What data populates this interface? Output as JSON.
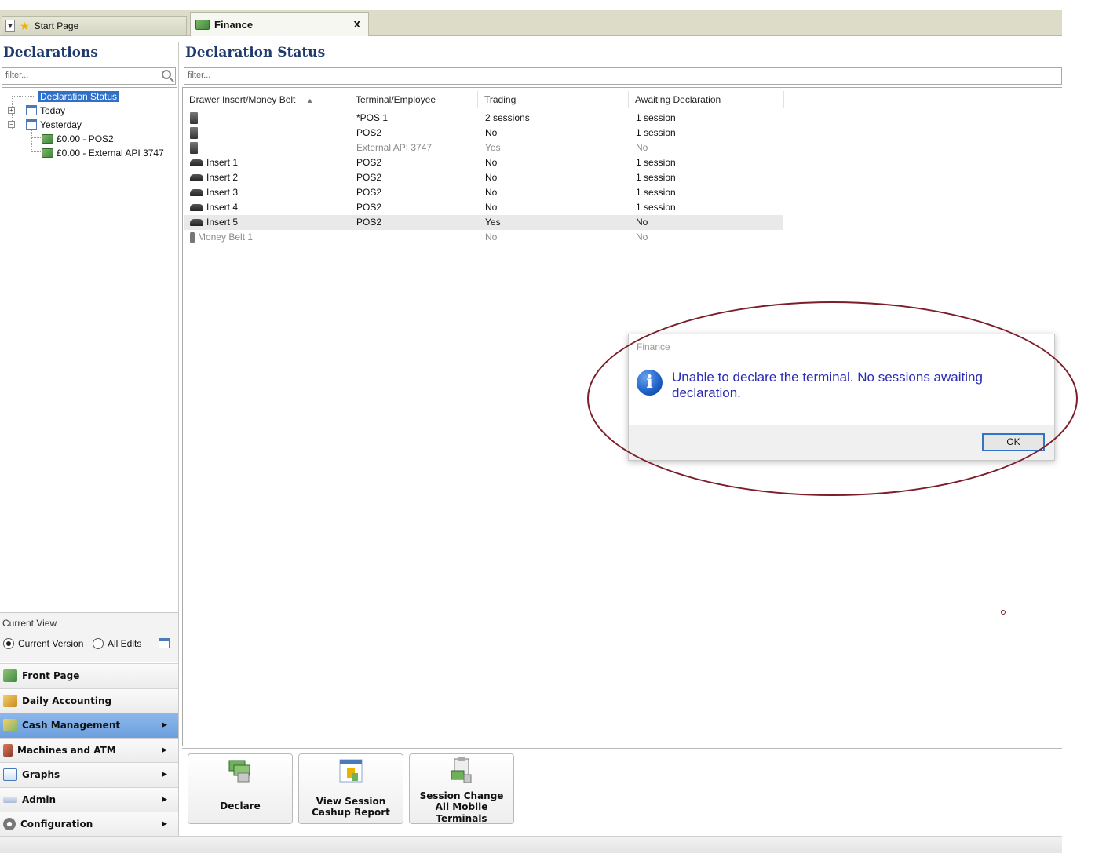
{
  "tabs": {
    "start_page": "Start Page",
    "finance": "Finance",
    "close_glyph": "x"
  },
  "left_panel": {
    "title": "Declarations",
    "filter_placeholder": "filter...",
    "tree": {
      "root": "Declaration Status",
      "today": "Today",
      "yesterday": "Yesterday",
      "child1": "£0.00 - POS2",
      "child2": "£0.00 - External API 3747"
    },
    "current_view": {
      "label": "Current View",
      "option1": "Current Version",
      "option2": "All Edits",
      "selected": "Current Version"
    },
    "nav": [
      {
        "label": "Front Page",
        "icon": "finance-icon"
      },
      {
        "label": "Daily Accounting",
        "icon": "accounting-icon"
      },
      {
        "label": "Cash Management",
        "icon": "cash-icon",
        "active": true
      },
      {
        "label": "Machines and ATM",
        "icon": "machine-icon"
      },
      {
        "label": "Graphs",
        "icon": "graph-icon"
      },
      {
        "label": "Admin",
        "icon": "admin-icon"
      },
      {
        "label": "Configuration",
        "icon": "gear-icon"
      }
    ]
  },
  "main_panel": {
    "title": "Declaration Status",
    "filter_placeholder": "filter...",
    "columns": [
      "Drawer Insert/Money Belt",
      "Terminal/Employee",
      "Trading",
      "Awaiting Declaration"
    ],
    "rows": [
      {
        "icon": "terminal-icon",
        "drawer": "",
        "terminal": "*POS 1",
        "trading": "2 sessions",
        "awaiting": "1 session"
      },
      {
        "icon": "terminal-icon",
        "drawer": "",
        "terminal": "POS2",
        "trading": "No",
        "awaiting": "1 session"
      },
      {
        "icon": "terminal-icon",
        "drawer": "",
        "terminal": "External API 3747",
        "trading": "Yes",
        "awaiting": "No",
        "dim": true
      },
      {
        "icon": "insert-icon",
        "drawer": "Insert 1",
        "terminal": "POS2",
        "trading": "No",
        "awaiting": "1 session"
      },
      {
        "icon": "insert-icon",
        "drawer": "Insert 2",
        "terminal": "POS2",
        "trading": "No",
        "awaiting": "1 session"
      },
      {
        "icon": "insert-icon",
        "drawer": "Insert 3",
        "terminal": "POS2",
        "trading": "No",
        "awaiting": "1 session"
      },
      {
        "icon": "insert-icon",
        "drawer": "Insert 4",
        "terminal": "POS2",
        "trading": "No",
        "awaiting": "1 session"
      },
      {
        "icon": "insert-icon",
        "drawer": "Insert 5",
        "terminal": "POS2",
        "trading": "Yes",
        "awaiting": "No",
        "highlight": true
      },
      {
        "icon": "person-icon",
        "drawer": "Money Belt 1",
        "terminal": "",
        "trading": "No",
        "awaiting": "No",
        "dim": true
      }
    ]
  },
  "actions": {
    "declare": "Declare",
    "view_session_line1": "View Session",
    "view_session_line2": "Cashup Report",
    "session_change_line1": "Session Change",
    "session_change_line2": "All Mobile",
    "session_change_line3": "Terminals"
  },
  "dialog": {
    "title": "Finance",
    "message": "Unable to declare the terminal. No sessions awaiting declaration.",
    "ok": "OK"
  },
  "colors": {
    "title_blue": "#1f3b6e",
    "selection": "#3070c8",
    "nav_active": "#7aaae4",
    "dialog_text": "#2b2bb3",
    "annotation": "#7c1e2a"
  }
}
